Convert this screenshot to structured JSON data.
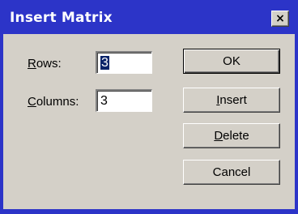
{
  "window": {
    "title": "Insert Matrix",
    "close_glyph": "×"
  },
  "form": {
    "rows_label_accel": "R",
    "rows_label_rest": "ows:",
    "rows_value": "3",
    "columns_label_accel": "C",
    "columns_label_rest": "olumns:",
    "columns_value": "3"
  },
  "buttons": {
    "ok_label": "OK",
    "insert_accel": "I",
    "insert_rest": "nsert",
    "delete_accel": "D",
    "delete_rest": "elete",
    "cancel_label": "Cancel"
  },
  "colors": {
    "titlebar": "#2c34c8",
    "face": "#d4d0c8",
    "selection": "#0a246a"
  }
}
